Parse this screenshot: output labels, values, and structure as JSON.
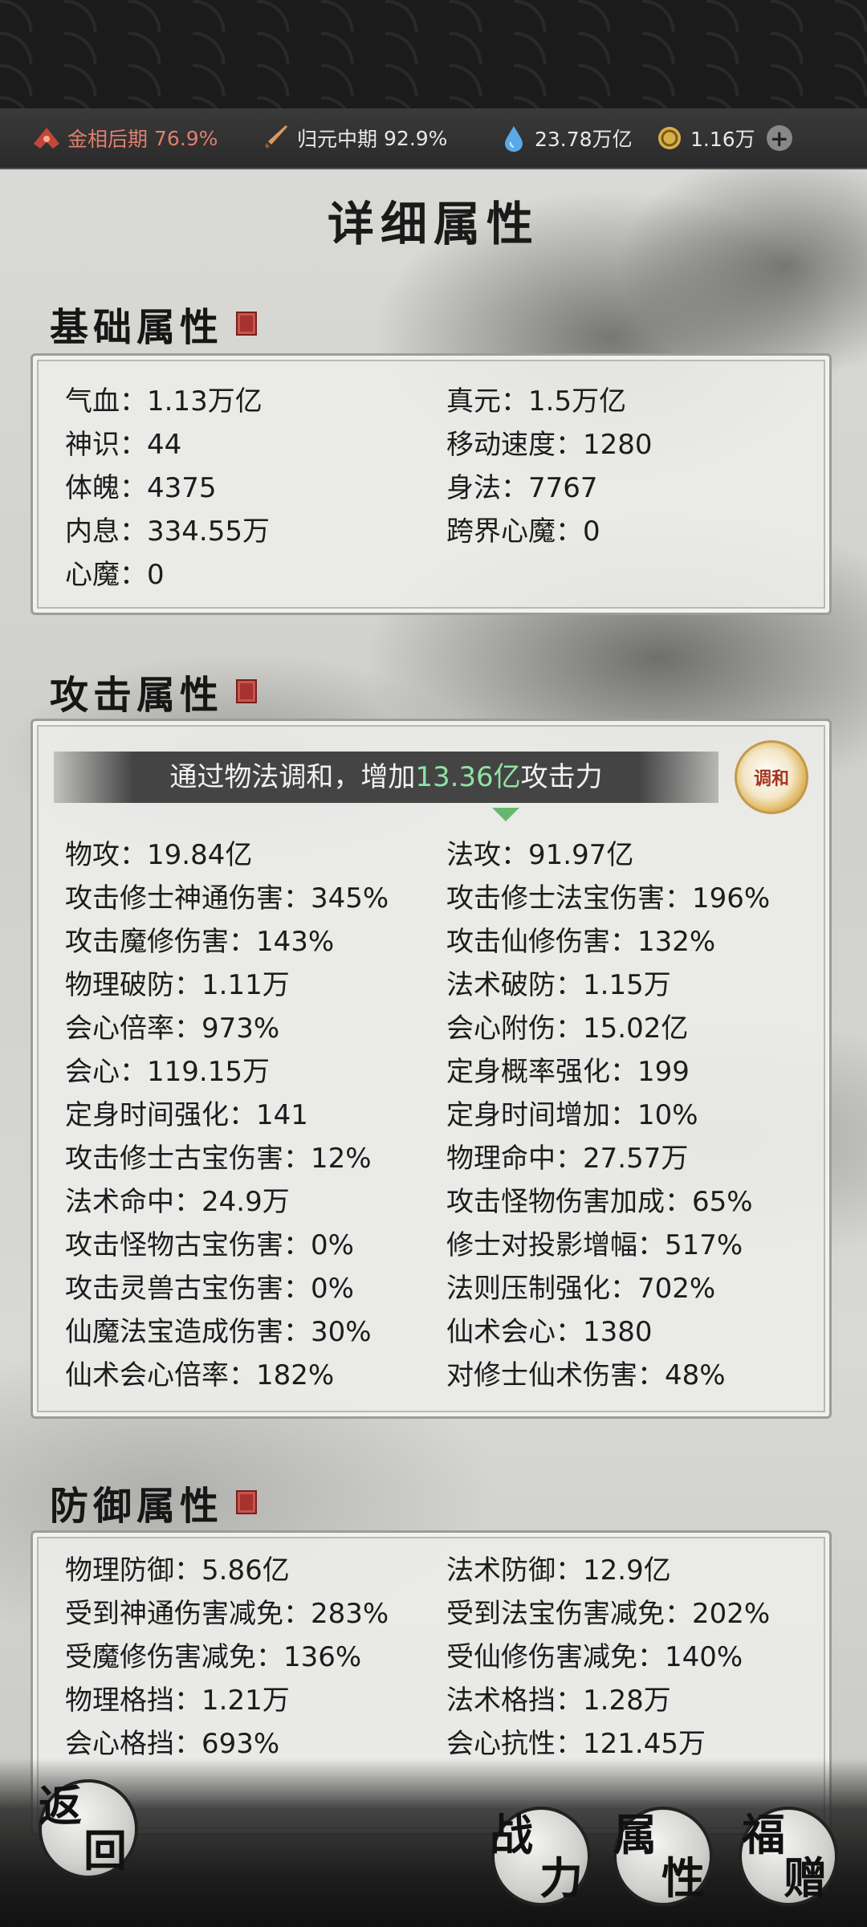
{
  "resources": [
    {
      "icon": "realm-icon",
      "label": "金相后期",
      "value": "76.9%"
    },
    {
      "icon": "sword-icon",
      "label": "归元中期",
      "value": "92.9%"
    },
    {
      "icon": "spirit-drop-icon",
      "label": "",
      "value": "23.78万亿"
    },
    {
      "icon": "coin-icon",
      "label": "",
      "value": "1.16万"
    }
  ],
  "page_title": "详细属性",
  "sections": {
    "basic": {
      "title": "基础属性",
      "rows": [
        [
          "气血：1.13万亿",
          "真元：1.5万亿"
        ],
        [
          "神识：44",
          "移动速度：1280"
        ],
        [
          "体魄：4375",
          "身法：7767"
        ],
        [
          "内息：334.55万",
          "跨界心魔：0"
        ],
        [
          "心魔：0",
          ""
        ]
      ]
    },
    "attack": {
      "title": "攻击属性",
      "banner_prefix": "通过物法调和，增加",
      "banner_value": "13.36亿",
      "banner_suffix": "攻击力",
      "harmony_label": "调和",
      "rows": [
        [
          "物攻：19.84亿",
          "法攻：91.97亿"
        ],
        [
          "攻击修士神通伤害：345%",
          "攻击修士法宝伤害：196%"
        ],
        [
          "攻击魔修伤害：143%",
          "攻击仙修伤害：132%"
        ],
        [
          "物理破防：1.11万",
          "法术破防：1.15万"
        ],
        [
          "会心倍率：973%",
          "会心附伤：15.02亿"
        ],
        [
          "会心：119.15万",
          "定身概率强化：199"
        ],
        [
          "定身时间强化：141",
          "定身时间增加：10%"
        ],
        [
          "攻击修士古宝伤害：12%",
          "物理命中：27.57万"
        ],
        [
          "法术命中：24.9万",
          "攻击怪物伤害加成：65%"
        ],
        [
          "攻击怪物古宝伤害：0%",
          "修士对投影增幅：517%"
        ],
        [
          "攻击灵兽古宝伤害：0%",
          "法则压制强化：702%"
        ],
        [
          "仙魔法宝造成伤害：30%",
          "仙术会心：1380"
        ],
        [
          "仙术会心倍率：182%",
          "对修士仙术伤害：48%"
        ]
      ]
    },
    "defense": {
      "title": "防御属性",
      "rows": [
        [
          "物理防御：5.86亿",
          "法术防御：12.9亿"
        ],
        [
          "受到神通伤害减免：283%",
          "受到法宝伤害减免：202%"
        ],
        [
          "受魔修伤害减免：136%",
          "受仙修伤害减免：140%"
        ],
        [
          "物理格挡：1.21万",
          "法术格挡：1.28万"
        ],
        [
          "会心格挡：693%",
          "会心抗性：121.45万"
        ]
      ]
    }
  },
  "bottom_nav": {
    "back": [
      "返",
      "回"
    ],
    "power": [
      "战",
      "力"
    ],
    "attributes": [
      "属",
      "性"
    ],
    "gift": [
      "福",
      "赠"
    ]
  }
}
